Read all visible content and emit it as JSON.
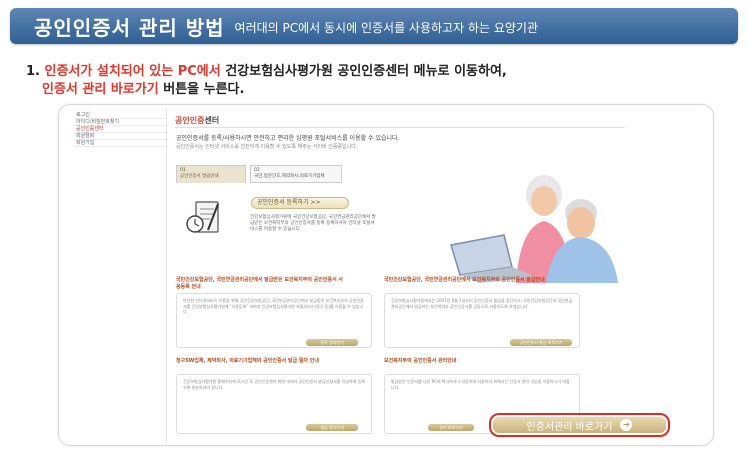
{
  "banner": {
    "title": "공인인증서 관리 방법",
    "subtitle": "여러대의 PC에서 동시에 인증서를 사용하고자 하는 요양기관"
  },
  "instruction": {
    "number": "1.",
    "part1_red": "인증서가 설치되어 있는 PC에서",
    "part2": " 건강보험심사평가원 공인인증센터 메뉴로 이동하여,",
    "part3_red": "인증서 관리 바로가기",
    "part4": " 버튼을 누른다."
  },
  "sidebar": {
    "items": [
      {
        "label": "로그인"
      },
      {
        "label": "아이디/비밀번호찾기"
      },
      {
        "label": "공인인증센터"
      },
      {
        "label": "회원탈퇴"
      },
      {
        "label": "회원가입"
      }
    ]
  },
  "page": {
    "title_red": "공인인증",
    "title_rest": "센터",
    "intro_main": "공인인증서를 등록/사용하시면 안전하고 편리한 심평원 포털서비스를 이용할 수 있습니다.",
    "intro_sub": "공인인증서는 인터넷 서비스를 안전하게 이용할 수 있도록 해주는 사이버 인증증입니다.",
    "tabs": [
      {
        "num": "01",
        "label": "공인인증서 발급안내"
      },
      {
        "num": "02",
        "label": "국민,방문간호,제약회사,의료기기업체"
      }
    ],
    "register_button": "공인인증서 등록하기 >>",
    "register_desc": "건강보험심사평가원에 국민건강보험공단, 국민연금관리공단에서 발급받은 보건복지부의 공인인증서를 등록 등록하셔야 인터넷 포털서비스를 이용할 수 있습니다."
  },
  "boxes": [
    {
      "title": "국민건강보험공단, 국민연금관리공단에서 발급받은 보건복지부의 공인인증서 사용등록 안내",
      "body": "안전한 인터넷서비스 이용을 위해 국민건강보험공단, 국민연금관리공단에서 발급받은 보건복지부의 공인인증서를 건강보험심사평가원에 \"사용등록\" 하여야 건강보험심사평가원 포털서비스(청구 등)를 이용할 수 있습니다.",
      "button": "등록 절차안내"
    },
    {
      "title": "국민건강보험공단, 국민연금관리공단에서 보건복지부의 공인인증서 발급안내",
      "body": "건강보험심사평가원에서는 2007년 8월 1일부터 공인인증서 발급을 중단하고, 국민건강보험공단과 국민연금관리공단에서 발급하는 보건복지부 공인인증서를 공동으로 사용하도록 하였습니다.",
      "button": "공인인증서 발급 바로가기"
    },
    {
      "title": "청구SW업체, 제약회사, 의료기기업체의 공인인증서 발급 절차 안내",
      "body": "건강보험심사평가원 홈페이지에 로그인 후 공인인증센터 화면 내에서 공인인증서 발급신청서를 작성하여 등록 우편 발송하셔야 합니다.",
      "button": "발급 절차안내"
    },
    {
      "title": "보건복지부의 공인인증서 관리안내",
      "body": "발급받은 인증서를 다른 PC에 복사하거나 이동하여 사용하기 위해서는 인증서 관리 기능을 이용하시기 바랍니다.",
      "button": "관리 바로가기"
    }
  ],
  "main_button": {
    "label": "인증서관리 바로가기",
    "arrow": "➔"
  },
  "colors": {
    "banner": "#3c6a9e",
    "accent_red": "#e5352b",
    "button_gold": "#c9b27a"
  }
}
